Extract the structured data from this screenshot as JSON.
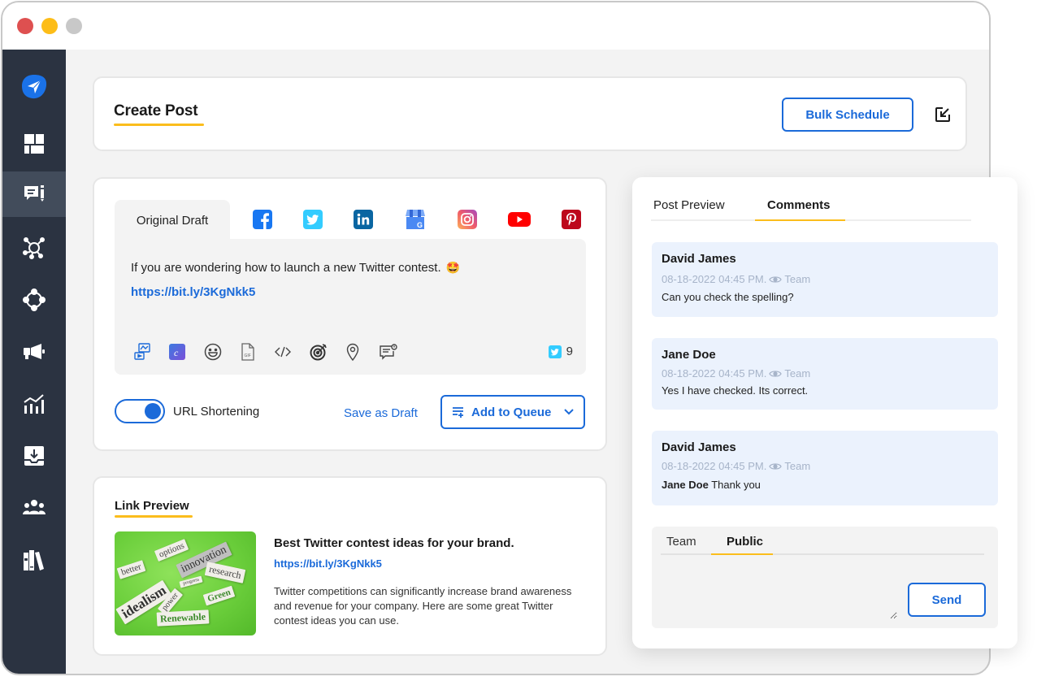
{
  "window": {
    "controls": [
      "close",
      "minimize",
      "maximize"
    ]
  },
  "sidebar": {
    "logo": "paper-plane-logo",
    "items": [
      {
        "icon": "dashboard-icon",
        "active": false
      },
      {
        "icon": "compose-icon",
        "active": true
      },
      {
        "icon": "network-icon",
        "active": false
      },
      {
        "icon": "nodes-icon",
        "active": false
      },
      {
        "icon": "megaphone-icon",
        "active": false
      },
      {
        "icon": "analytics-icon",
        "active": false
      },
      {
        "icon": "inbox-download-icon",
        "active": false
      },
      {
        "icon": "team-icon",
        "active": false
      },
      {
        "icon": "library-icon",
        "active": false
      }
    ]
  },
  "header": {
    "title": "Create Post",
    "bulk_schedule_label": "Bulk Schedule",
    "collapse_icon": "collapse-arrow-icon"
  },
  "composer": {
    "tab_original": "Original Draft",
    "networks": [
      "facebook",
      "twitter",
      "linkedin",
      "google-business",
      "instagram",
      "youtube",
      "pinterest"
    ],
    "text": "If you are wondering how to launch a new Twitter contest.",
    "emoji": "🤩",
    "link": "https://bit.ly/3KgNkk5",
    "tools": [
      "media-icon",
      "canva-icon",
      "emoji-icon",
      "gif-icon",
      "code-icon",
      "target-icon",
      "location-icon",
      "poll-icon"
    ],
    "char_count": "9",
    "url_shortening_label": "URL Shortening",
    "url_shortening_on": true,
    "save_draft_label": "Save as Draft",
    "add_to_queue_label": "Add to Queue"
  },
  "link_preview": {
    "section_title": "Link Preview",
    "image_words": [
      "better",
      "options",
      "innovation",
      "research",
      "idealism",
      "progress",
      "power",
      "Green",
      "Renewable"
    ],
    "headline": "Best Twitter contest ideas for your brand.",
    "url": "https://bit.ly/3KgNkk5",
    "description": "Twitter competitions can significantly increase brand awareness and revenue for your company. Here are some great Twitter contest ideas you can use."
  },
  "comments_panel": {
    "tabs": [
      {
        "label": "Post Preview",
        "active": false
      },
      {
        "label": "Comments",
        "active": true
      }
    ],
    "comments": [
      {
        "author": "David James",
        "timestamp": "08-18-2022 04:45 PM.",
        "visibility": "Team",
        "mention": "",
        "text": "Can you check the spelling?"
      },
      {
        "author": "Jane Doe",
        "timestamp": "08-18-2022 04:45 PM.",
        "visibility": "Team",
        "mention": "",
        "text": "Yes I have checked. Its correct."
      },
      {
        "author": "David James",
        "timestamp": "08-18-2022 04:45 PM.",
        "visibility": "Team",
        "mention": "Jane Doe",
        "text": "Thank you"
      }
    ],
    "reply": {
      "tabs": [
        {
          "label": "Team",
          "active": false
        },
        {
          "label": "Public",
          "active": true
        }
      ],
      "input_value": "",
      "send_label": "Send"
    }
  }
}
